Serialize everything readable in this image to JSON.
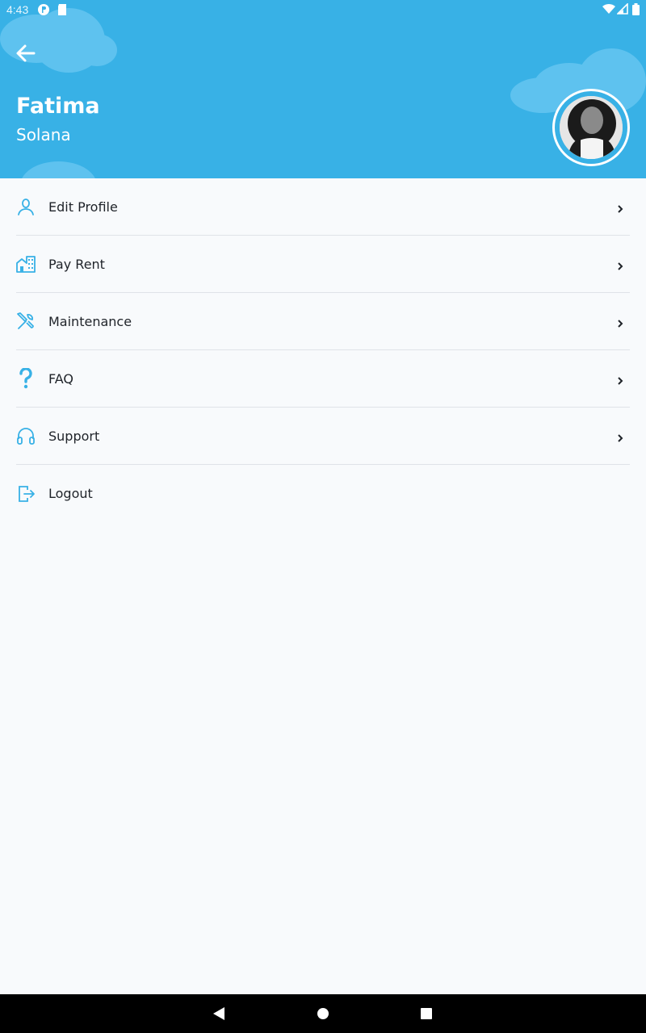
{
  "status_bar": {
    "time": "4:43"
  },
  "header": {
    "first_name": "Fatima",
    "last_name": "Solana",
    "background_color": "#38b1e6"
  },
  "menu": {
    "items": [
      {
        "label": "Edit Profile",
        "icon": "user-icon",
        "has_chevron": true
      },
      {
        "label": "Pay Rent",
        "icon": "building-icon",
        "has_chevron": true
      },
      {
        "label": "Maintenance",
        "icon": "tools-icon",
        "has_chevron": true
      },
      {
        "label": "FAQ",
        "icon": "question-icon",
        "has_chevron": true
      },
      {
        "label": "Support",
        "icon": "headphones-icon",
        "has_chevron": true
      },
      {
        "label": "Logout",
        "icon": "logout-icon",
        "has_chevron": false
      }
    ]
  },
  "colors": {
    "accent": "#38b1e6",
    "text": "#1f2329"
  }
}
